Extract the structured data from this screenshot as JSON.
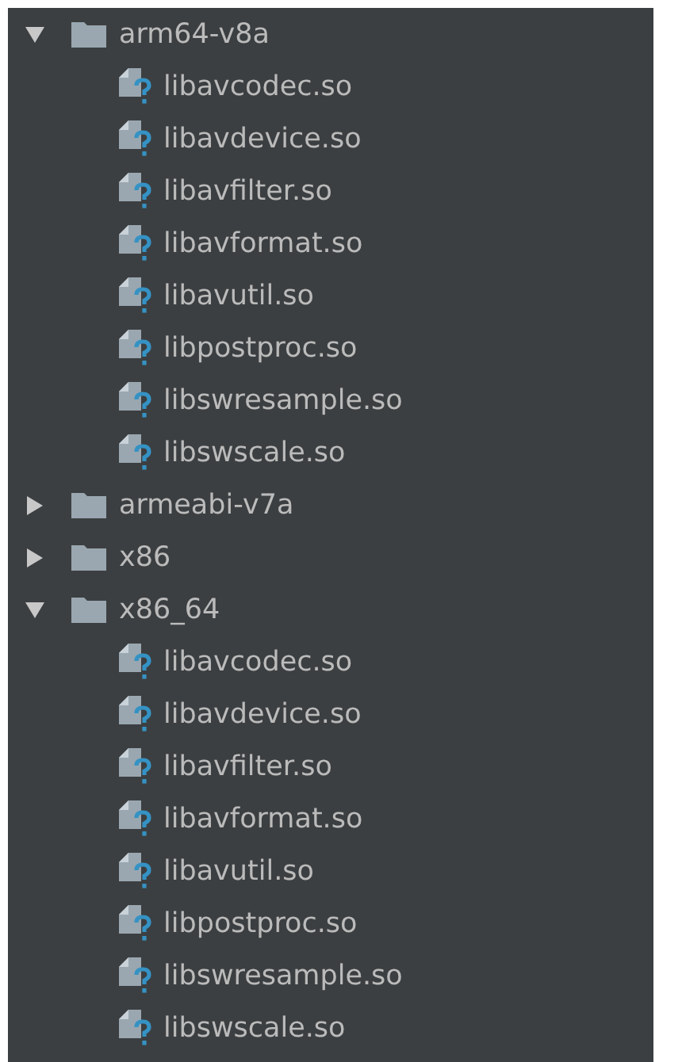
{
  "tree": [
    {
      "kind": "folder",
      "name": "arm64-v8a",
      "expanded": true,
      "children": [
        {
          "kind": "file",
          "name": "libavcodec.so"
        },
        {
          "kind": "file",
          "name": "libavdevice.so"
        },
        {
          "kind": "file",
          "name": "libavfilter.so"
        },
        {
          "kind": "file",
          "name": "libavformat.so"
        },
        {
          "kind": "file",
          "name": "libavutil.so"
        },
        {
          "kind": "file",
          "name": "libpostproc.so"
        },
        {
          "kind": "file",
          "name": "libswresample.so"
        },
        {
          "kind": "file",
          "name": "libswscale.so"
        }
      ]
    },
    {
      "kind": "folder",
      "name": "armeabi-v7a",
      "expanded": false
    },
    {
      "kind": "folder",
      "name": "x86",
      "expanded": false
    },
    {
      "kind": "folder",
      "name": "x86_64",
      "expanded": true,
      "children": [
        {
          "kind": "file",
          "name": "libavcodec.so"
        },
        {
          "kind": "file",
          "name": "libavdevice.so"
        },
        {
          "kind": "file",
          "name": "libavfilter.so"
        },
        {
          "kind": "file",
          "name": "libavformat.so"
        },
        {
          "kind": "file",
          "name": "libavutil.so"
        },
        {
          "kind": "file",
          "name": "libpostproc.so"
        },
        {
          "kind": "file",
          "name": "libswresample.so"
        },
        {
          "kind": "file",
          "name": "libswscale.so"
        }
      ]
    }
  ]
}
